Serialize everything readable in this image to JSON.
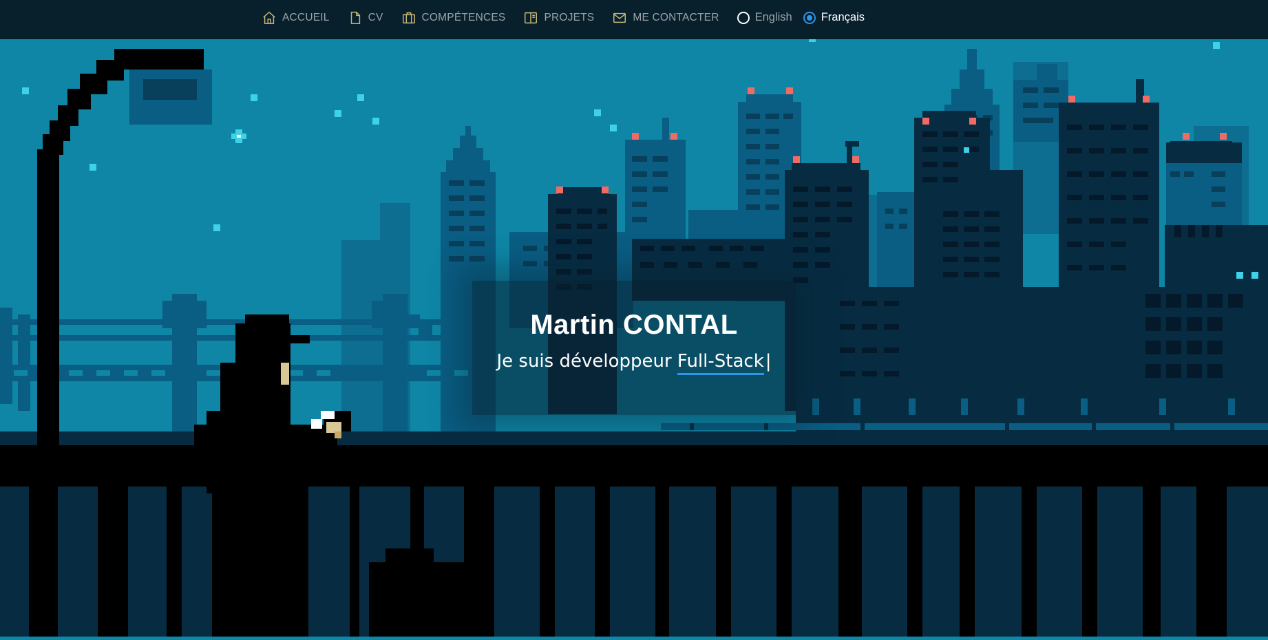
{
  "nav": {
    "items": [
      {
        "label": "ACCUEIL",
        "icon": "home-icon"
      },
      {
        "label": "CV",
        "icon": "file-icon"
      },
      {
        "label": "COMPÉTENCES",
        "icon": "briefcase-icon"
      },
      {
        "label": "PROJETS",
        "icon": "book-icon"
      },
      {
        "label": "ME CONTACTER",
        "icon": "mail-icon"
      }
    ],
    "languages": [
      {
        "label": "English",
        "selected": false
      },
      {
        "label": "Français",
        "selected": true
      }
    ]
  },
  "hero": {
    "name": "Martin CONTAL",
    "subtitle_prefix": "Je suis développeur",
    "subtitle_typed": "Full-Stack",
    "cursor": "|"
  },
  "colors": {
    "navbar_bg": "#08202c",
    "nav_icon": "#c9b878",
    "nav_text": "#9aa3a7",
    "accent": "#2f95e8",
    "sky": "#0f86a6",
    "city_far": "#0d6e92",
    "city_mid": "#0a5d83",
    "city_near": "#072c42",
    "foreground": "#000000",
    "window_light": "#3fd1e8",
    "antenna_light": "#ef6b63"
  }
}
